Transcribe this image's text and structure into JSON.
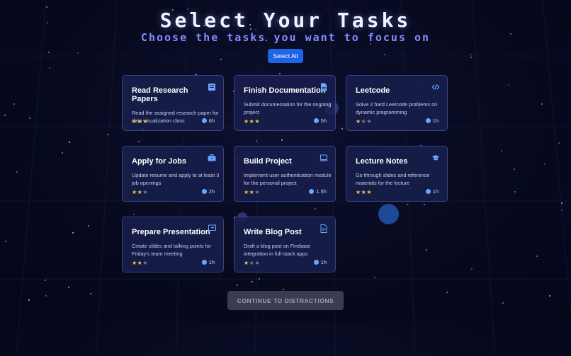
{
  "header": {
    "title": "Select Your Tasks",
    "subtitle": "Choose the tasks you want to focus on",
    "select_all_label": "Select All"
  },
  "colors": {
    "accent": "#1e63e8",
    "card_bg": "#18204e",
    "star_on": "#f6c945",
    "star_off": "#7a7f96",
    "icon": "#6aa6ff"
  },
  "tasks": [
    {
      "title": "Read Research Papers",
      "desc": "Read the assigned research paper for data visualization class",
      "rating": 3,
      "time": "6h",
      "icon": "book-icon"
    },
    {
      "title": "Finish Documentation",
      "desc": "Submit documentation for the ongoing project",
      "rating": 3,
      "time": "5h",
      "icon": "document-icon"
    },
    {
      "title": "Leetcode",
      "desc": "Solve 2 hard Leetcode problems on dynamic programming",
      "rating": 1,
      "time": "1h",
      "icon": "code-icon"
    },
    {
      "title": "Apply for Jobs",
      "desc": "Update resume and apply to at least 3 job openings",
      "rating": 2,
      "time": "2h",
      "icon": "briefcase-icon"
    },
    {
      "title": "Build Project",
      "desc": "Implement user authentication module for the personal project",
      "rating": 2,
      "time": "1.5h",
      "icon": "laptop-icon"
    },
    {
      "title": "Lecture Notes",
      "desc": "Go through slides and reference materials for the lecture",
      "rating": 3,
      "time": "1h",
      "icon": "graduation-cap-icon"
    },
    {
      "title": "Prepare Presentation",
      "desc": "Create slides and talking points for Friday's team meeting",
      "rating": 2,
      "time": "1h",
      "icon": "presentation-icon"
    },
    {
      "title": "Write Blog Post",
      "desc": "Draft a blog post on Firebase integration in full-stack apps",
      "rating": 1,
      "time": "1h",
      "icon": "file-text-icon"
    }
  ],
  "footer": {
    "continue_label": "CONTINUE TO DISTRACTIONS"
  }
}
